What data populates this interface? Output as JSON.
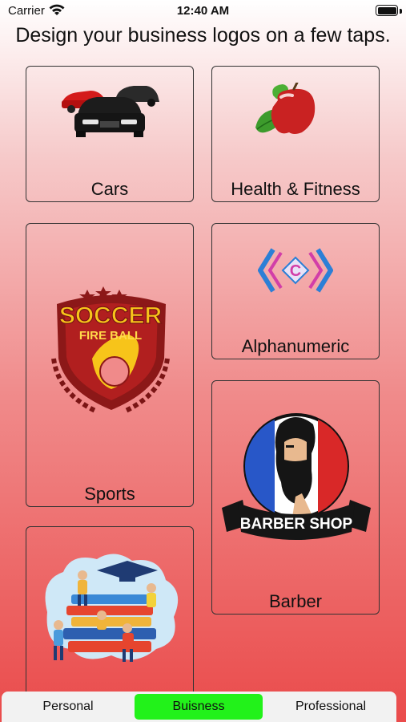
{
  "status_bar": {
    "carrier": "Carrier",
    "time": "12:40 AM",
    "battery_level": 1.0
  },
  "headline": "Design your business logos on a few taps.",
  "categories": [
    {
      "label": "Cars",
      "icon": "cars-icon"
    },
    {
      "label": "Health & Fitness",
      "icon": "apple-icon"
    },
    {
      "label": "Sports",
      "icon": "soccer-logo"
    },
    {
      "label": "Alphanumeric",
      "icon": "letter-c-logo"
    },
    {
      "label": "Barber",
      "icon": "barber-shop-logo"
    },
    {
      "label": "",
      "icon": "education-books-logo"
    }
  ],
  "logo_text": {
    "soccer_title": "SOCCER",
    "soccer_sub": "FIRE BALL",
    "barber_banner": "BARBER SHOP",
    "alpha_letter": "C"
  },
  "tabs": [
    {
      "label": "Personal",
      "active": false
    },
    {
      "label": "Buisness",
      "active": true
    },
    {
      "label": "Professional",
      "active": false
    }
  ],
  "colors": {
    "active_tab": "#22f21a",
    "gradient_bottom": "#ea4b4b"
  }
}
